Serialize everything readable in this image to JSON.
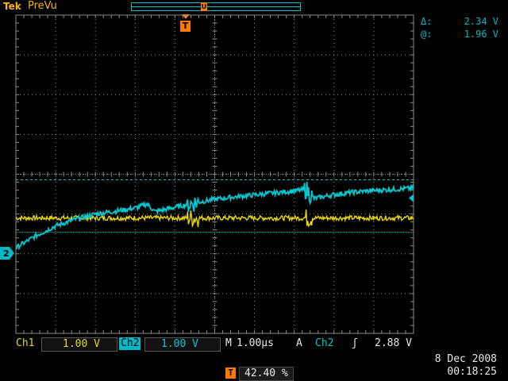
{
  "header": {
    "brand": "Tek",
    "mode": "PreVu",
    "trigger_marker": "T",
    "record_marker": "U"
  },
  "readouts": {
    "delta_symbol": "Δ:",
    "delta_value": "2.34 V",
    "at_symbol": "@:",
    "at_value": "1.96 V"
  },
  "channel_marker": "2",
  "status": {
    "ch1_label": "Ch1",
    "ch1_scale": "1.00 V",
    "ch2_label": "Ch2",
    "ch2_scale": "1.00 V",
    "timebase_label": "M",
    "timebase": "1.00µs",
    "trigger_mode": "A",
    "trigger_source": "Ch2",
    "trigger_slope": "ʃ",
    "trigger_level": "2.88 V"
  },
  "footer": {
    "date": "8 Dec 2008",
    "time": "00:18:25",
    "trigger_position": "42.40 %",
    "trigger_icon": "T"
  },
  "colors": {
    "ch1": "#e8d800",
    "ch2": "#00c8d0",
    "trigger": "#ff7a00",
    "grid": "#8a8a8a"
  },
  "chart_data": {
    "type": "line",
    "xlabel": "",
    "ylabel": "",
    "x_divisions": 10,
    "y_divisions": 8,
    "series": [
      {
        "name": "Ch1",
        "x": [
          0,
          1,
          2,
          3,
          4,
          5,
          6,
          7,
          8,
          9,
          10
        ],
        "y": [
          2.9,
          2.9,
          2.9,
          2.9,
          2.9,
          2.9,
          2.9,
          2.9,
          2.9,
          2.9,
          2.9
        ]
      },
      {
        "name": "Ch2",
        "x": [
          0,
          0.5,
          1,
          1.5,
          2,
          2.5,
          3,
          3.3,
          3.5,
          4,
          4.5,
          5,
          5.5,
          6,
          6.5,
          7,
          7.3,
          7.5,
          8,
          8.5,
          9,
          9.5,
          10
        ],
        "y": [
          2.15,
          2.45,
          2.7,
          2.87,
          3.0,
          3.07,
          3.15,
          3.25,
          3.06,
          3.17,
          3.28,
          3.37,
          3.43,
          3.48,
          3.53,
          3.58,
          3.62,
          3.39,
          3.49,
          3.55,
          3.59,
          3.62,
          3.65
        ]
      }
    ],
    "ref_lines": [
      3.86,
      2.54
    ],
    "trigger_level_y": 3.4,
    "ch2_ground": 0
  }
}
